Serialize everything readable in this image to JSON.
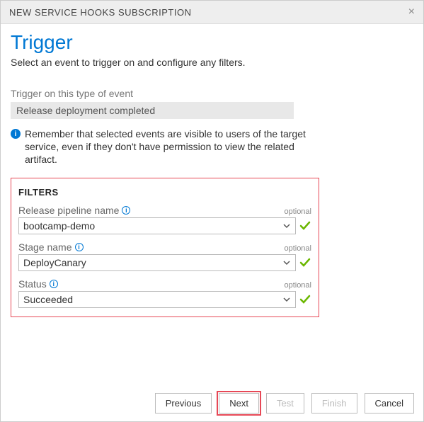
{
  "header": {
    "title": "NEW SERVICE HOOKS SUBSCRIPTION"
  },
  "page": {
    "title": "Trigger",
    "subtitle": "Select an event to trigger on and configure any filters."
  },
  "trigger": {
    "label": "Trigger on this type of event",
    "value": "Release deployment completed"
  },
  "note": {
    "text": "Remember that selected events are visible to users of the target service, even if they don't have permission to view the related artifact."
  },
  "filters": {
    "title": "FILTERS",
    "optional_label": "optional",
    "fields": [
      {
        "label": "Release pipeline name",
        "value": "bootcamp-demo"
      },
      {
        "label": "Stage name",
        "value": "DeployCanary"
      },
      {
        "label": "Status",
        "value": "Succeeded"
      }
    ]
  },
  "buttons": {
    "previous": "Previous",
    "next": "Next",
    "test": "Test",
    "finish": "Finish",
    "cancel": "Cancel"
  }
}
